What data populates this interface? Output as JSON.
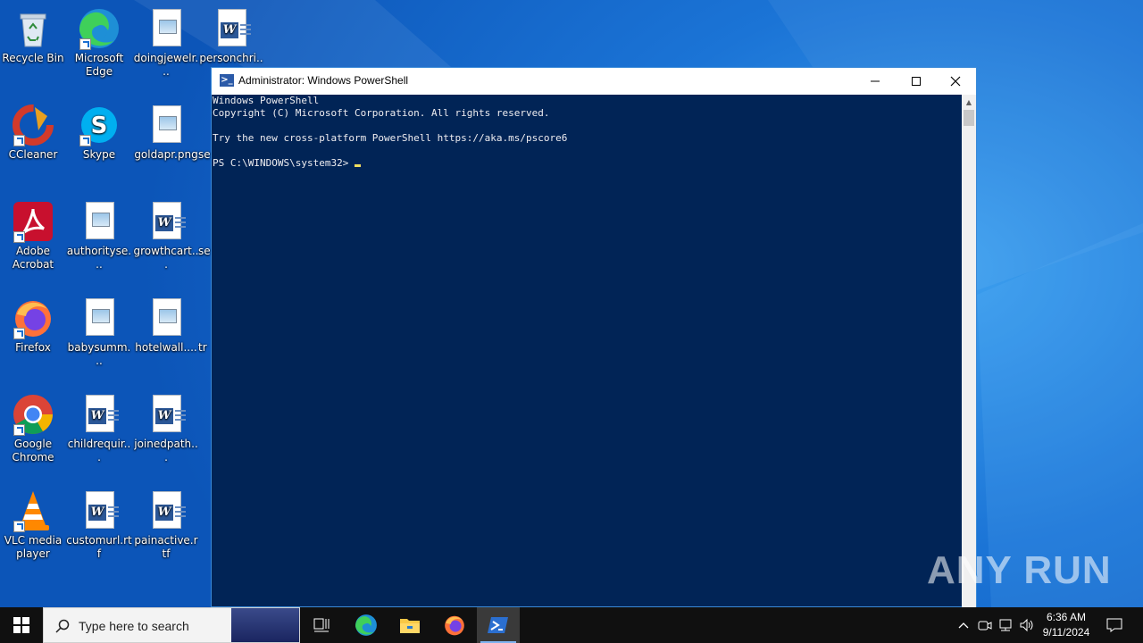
{
  "desktop": {
    "icons": [
      {
        "label": "Recycle Bin",
        "icon": "recycle-bin-icon"
      },
      {
        "label": "Microsoft Edge",
        "icon": "edge-icon"
      },
      {
        "label": "doingjewelr...",
        "icon": "image-file-icon"
      },
      {
        "label": "personchri...",
        "icon": "word-doc-icon"
      },
      {
        "label": "CCleaner",
        "icon": "ccleaner-icon"
      },
      {
        "label": "Skype",
        "icon": "skype-icon"
      },
      {
        "label": "goldapr.png",
        "icon": "image-file-icon"
      },
      {
        "label": "se",
        "icon": "partial-icon"
      },
      {
        "label": "Adobe Acrobat",
        "icon": "acrobat-icon"
      },
      {
        "label": "authorityse...",
        "icon": "image-file-icon"
      },
      {
        "label": "growthcart...",
        "icon": "word-doc-icon"
      },
      {
        "label": "se",
        "icon": "partial-icon"
      },
      {
        "label": "Firefox",
        "icon": "firefox-icon"
      },
      {
        "label": "babysumm...",
        "icon": "image-file-icon"
      },
      {
        "label": "hotelwall....",
        "icon": "image-file-icon"
      },
      {
        "label": "tr",
        "icon": "partial-icon"
      },
      {
        "label": "Google Chrome",
        "icon": "chrome-icon"
      },
      {
        "label": "childrequir...",
        "icon": "word-doc-icon"
      },
      {
        "label": "joinedpath...",
        "icon": "word-doc-icon"
      },
      {
        "label": "VLC media player",
        "icon": "vlc-icon"
      },
      {
        "label": "customurl.rtf",
        "icon": "word-doc-icon"
      },
      {
        "label": "painactive.rtf",
        "icon": "word-doc-icon"
      }
    ]
  },
  "window": {
    "title": "Administrator: Windows PowerShell",
    "console_lines": [
      "Windows PowerShell",
      "Copyright (C) Microsoft Corporation. All rights reserved.",
      "",
      "Try the new cross-platform PowerShell https://aka.ms/pscore6",
      "",
      "PS C:\\WINDOWS\\system32>"
    ],
    "colors": {
      "background": "#012456",
      "text": "#eeedf0",
      "cursor": "#f0e060"
    }
  },
  "watermark": {
    "text": "ANY RUN"
  },
  "taskbar": {
    "search_placeholder": "Type here to search",
    "apps": [
      "task-view-icon",
      "edge-icon",
      "file-explorer-icon",
      "firefox-icon",
      "powershell-icon"
    ],
    "clock_time": "6:36 AM",
    "clock_date": "9/11/2024"
  }
}
